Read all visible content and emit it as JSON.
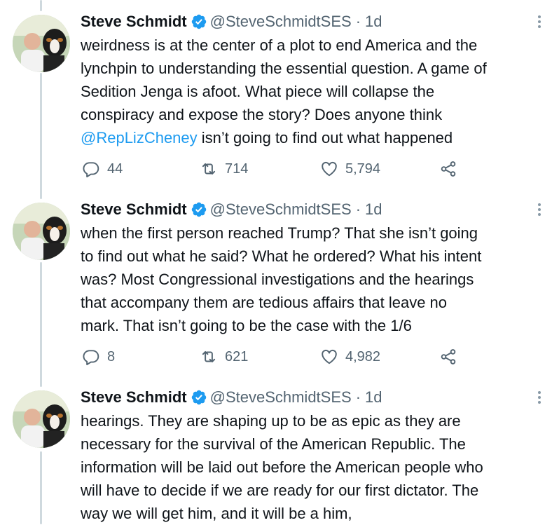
{
  "colors": {
    "accent": "#1d9bf0",
    "text": "#0f1419",
    "secondary": "#536471",
    "line": "#cfd9de"
  },
  "tweets": [
    {
      "name": "Steve Schmidt",
      "handle": "@SteveSchmidtSES",
      "dot": "·",
      "time": "1d",
      "lines": [
        "weirdness is at the center of a plot to end America and the",
        "lynchpin to understanding the essential question. A game of",
        "Sedition Jenga is afoot. What piece will collapse the",
        "conspiracy and expose the story? Does anyone think"
      ],
      "mention": "@RepLizCheney",
      "mention_tail": " isn’t going to find out what happened",
      "replies": "44",
      "retweets": "714",
      "likes": "5,794"
    },
    {
      "name": "Steve Schmidt",
      "handle": "@SteveSchmidtSES",
      "dot": "·",
      "time": "1d",
      "lines": [
        "when the first person reached Trump? That she isn’t going",
        "to find out what he said? What he ordered? What his intent",
        "was? Most Congressional investigations and the hearings",
        "that accompany them are tedious affairs that leave no",
        "mark. That isn’t going to be the case with the 1/6"
      ],
      "replies": "8",
      "retweets": "621",
      "likes": "4,982"
    },
    {
      "name": "Steve Schmidt",
      "handle": "@SteveSchmidtSES",
      "dot": "·",
      "time": "1d",
      "lines": [
        "hearings. They are shaping up to be as epic as they are",
        "necessary for the survival of the American Republic. The",
        "information will be laid out before the American people who",
        "will have to decide if we are ready for our first dictator. The",
        "way we will get him, and it will be a him,"
      ]
    }
  ]
}
